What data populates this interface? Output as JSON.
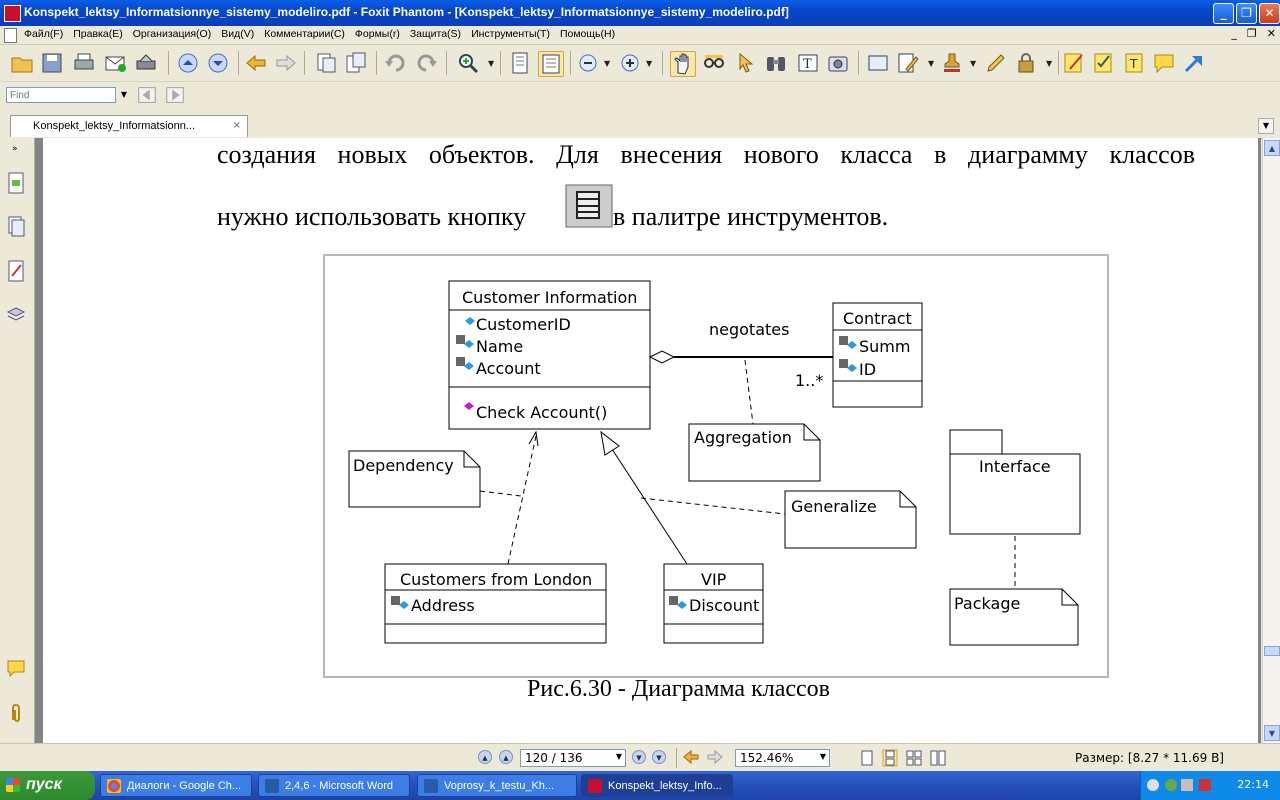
{
  "window": {
    "title": "Konspekt_lektsy_Informatsionnye_sistemy_modeliro.pdf - Foxit Phantom - [Konspekt_lektsy_Informatsionnye_sistemy_modeliro.pdf]"
  },
  "menu": {
    "items": [
      "Файл(F)",
      "Правка(E)",
      "Организация(O)",
      "Вид(V)",
      "Комментарии(C)",
      "Формы(r)",
      "Защита(S)",
      "Инструменты(T)",
      "Помощь(H)"
    ]
  },
  "find": {
    "placeholder": "Find"
  },
  "tab": {
    "label": "Konspekt_lektsy_Informatsionn...",
    "close": "×"
  },
  "document": {
    "line1": "создания новых объектов. Для внесения нового класса в диаграмму классов",
    "line2_before": "нужно использовать кнопку",
    "line2_after": "в палитре инструментов.",
    "caption": "Рис.6.30 - Диаграмма классов"
  },
  "diagram": {
    "customer_class": {
      "name": "Customer  Information",
      "attrs": [
        "CustomerID",
        "Name",
        "Account"
      ],
      "op": "Check Account()"
    },
    "contract_class": {
      "name": "Contract",
      "attrs": [
        "Summ",
        "ID"
      ]
    },
    "association_label": "negotates",
    "multiplicity": "1..*",
    "notes": [
      "Aggregation",
      "Dependency",
      "Generalize",
      "Package"
    ],
    "interface_package": "Interface",
    "london_class": {
      "name": "Customers from London",
      "attr": "Address"
    },
    "vip_class": {
      "name": "VIP",
      "attr": "Discount"
    }
  },
  "status": {
    "page": "120 / 136",
    "zoom": "152.46%",
    "size": "Размер: [8.27 * 11.69 В]"
  },
  "taskbar": {
    "start": "пуск",
    "tasks": [
      "Диалоги - Google Ch...",
      "2,4,6 - Microsoft Word",
      "Voprosy_k_testu_Kh...",
      "Konspekt_lektsy_Info..."
    ],
    "clock": "22:14"
  }
}
